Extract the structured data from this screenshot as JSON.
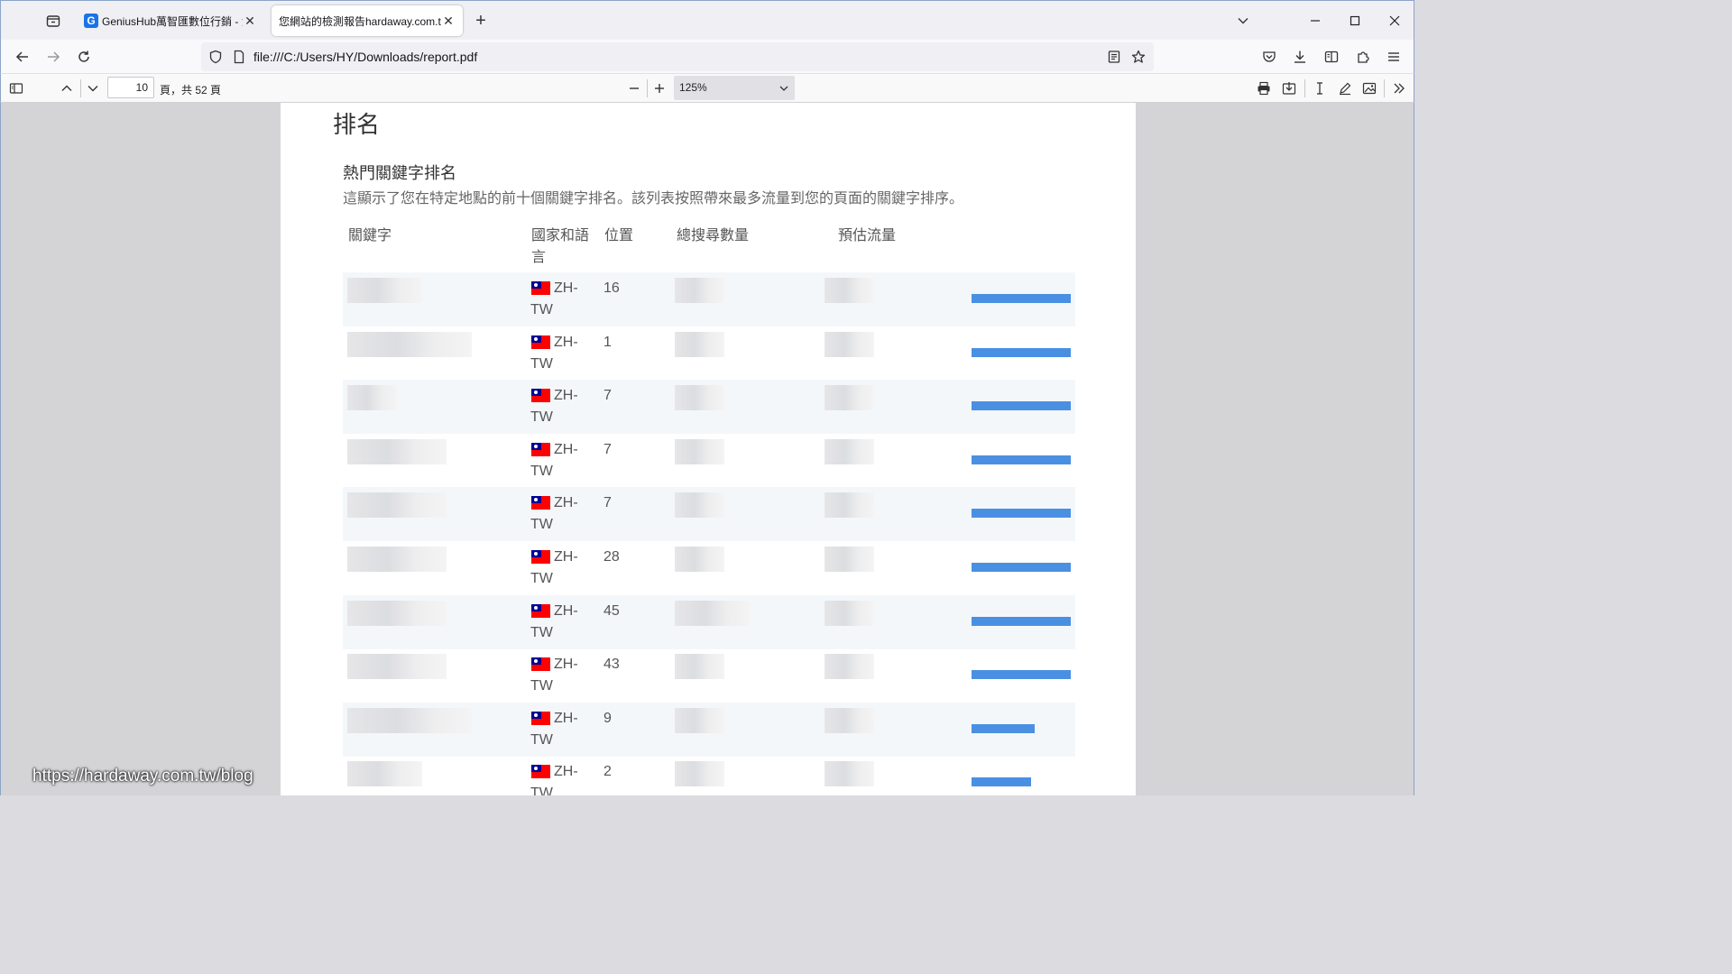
{
  "browser": {
    "tabs": [
      {
        "label": "GeniusHub萬智匯數位行銷 - 免",
        "favicon": "G",
        "active": false
      },
      {
        "label": "您網站的檢測報告hardaway.com.tw",
        "active": true
      }
    ],
    "url": "file:///C:/Users/HY/Downloads/report.pdf"
  },
  "pdf_toolbar": {
    "current_page": "10",
    "page_count_text": "頁，共 52 頁",
    "zoom": "125%"
  },
  "report": {
    "section_title": "排名",
    "subtitle": "熱門關鍵字排名",
    "description": "這顯示了您在特定地點的前十個關鍵字排名。該列表按照帶來最多流量到您的頁面的關鍵字排序。",
    "columns": {
      "keyword": "關鍵字",
      "country_language": "國家和語言",
      "position": "位置",
      "total_searches": "總搜尋數量",
      "estimated_traffic": "預估流量"
    },
    "rows": [
      {
        "lang_top": "ZH-",
        "lang_bottom": "TW",
        "position": "16",
        "traffic_share": 1.0
      },
      {
        "lang_top": "ZH-",
        "lang_bottom": "TW",
        "position": "1",
        "traffic_share": 1.0
      },
      {
        "lang_top": "ZH-",
        "lang_bottom": "TW",
        "position": "7",
        "traffic_share": 1.0
      },
      {
        "lang_top": "ZH-",
        "lang_bottom": "TW",
        "position": "7",
        "traffic_share": 1.0
      },
      {
        "lang_top": "ZH-",
        "lang_bottom": "TW",
        "position": "7",
        "traffic_share": 1.0
      },
      {
        "lang_top": "ZH-",
        "lang_bottom": "TW",
        "position": "28",
        "traffic_share": 1.0
      },
      {
        "lang_top": "ZH-",
        "lang_bottom": "TW",
        "position": "45",
        "traffic_share": 1.0
      },
      {
        "lang_top": "ZH-",
        "lang_bottom": "TW",
        "position": "43",
        "traffic_share": 1.0
      },
      {
        "lang_top": "ZH-",
        "lang_bottom": "TW",
        "position": "9",
        "traffic_share": 0.64
      },
      {
        "lang_top": "ZH-",
        "lang_bottom": "TW",
        "position": "2",
        "traffic_share": 0.6
      }
    ]
  },
  "watermark": "https://hardaway.com.tw/blog",
  "icons": [
    "tab-list-icon",
    "google-favicon",
    "close-icon",
    "plus-icon",
    "chevron-down-icon",
    "minimize-icon",
    "maximize-icon",
    "back-icon",
    "forward-icon",
    "reload-icon",
    "shield-icon",
    "page-icon",
    "reader-icon",
    "star-icon",
    "pocket-icon",
    "download-icon",
    "sidebar-icon",
    "extensions-icon",
    "menu-icon",
    "sidebar-toggle-icon",
    "chevron-up-icon",
    "minus-icon",
    "print-icon",
    "save-icon",
    "text-cursor-icon",
    "draw-icon",
    "image-icon",
    "tools-icon",
    "flag-tw-icon"
  ]
}
